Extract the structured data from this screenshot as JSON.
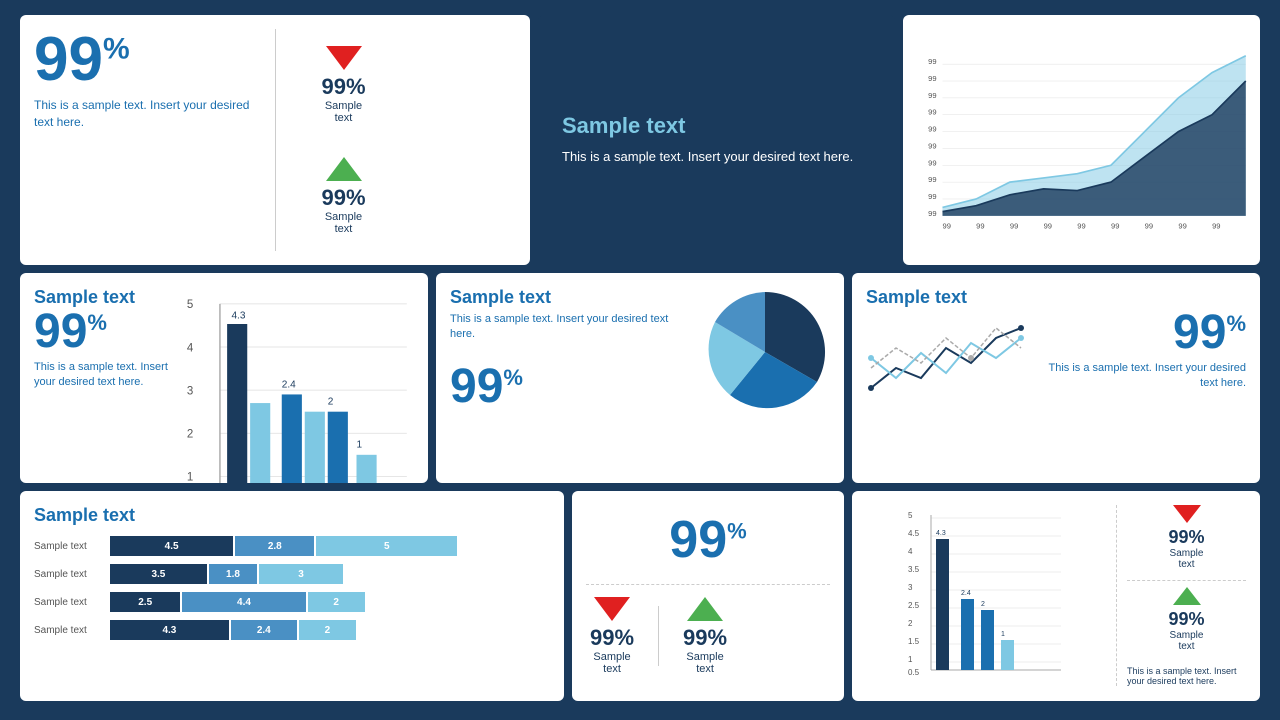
{
  "colors": {
    "dark_blue": "#1a3a5c",
    "mid_blue": "#1a6faf",
    "light_blue": "#7ec8e3",
    "accent_blue": "#4a90c4",
    "red": "#e02020",
    "green": "#4caf50",
    "white": "#ffffff"
  },
  "card1": {
    "big_percent": "99",
    "big_suffix": "%",
    "desc": "This is a sample text. Insert your desired text here.",
    "arrow1": {
      "percent": "99%",
      "label": "Sample\ntext",
      "type": "down"
    },
    "arrow2": {
      "percent": "99%",
      "label": "Sample\ntext",
      "type": "up"
    }
  },
  "card_dark": {
    "title": "Sample text",
    "desc": "This is a sample text. Insert your desired text here."
  },
  "card_bar1": {
    "title": "Sample text",
    "big_percent": "99",
    "big_suffix": "%",
    "desc": "This is a sample text. Insert your desired text here.",
    "bars": [
      {
        "label": "4.3",
        "value": 4.3
      },
      {
        "label": "2.4",
        "value": 2.4
      },
      {
        "label": "2",
        "value": 2.0
      },
      {
        "label": "1",
        "value": 1.0
      }
    ]
  },
  "card_pie": {
    "title": "Sample text",
    "desc": "This is a sample text. Insert your desired text here.",
    "big_percent": "99",
    "big_suffix": "%",
    "slices": [
      {
        "color": "#1a3a5c",
        "pct": 40
      },
      {
        "color": "#1a6faf",
        "pct": 25
      },
      {
        "color": "#7ec8e3",
        "pct": 20
      },
      {
        "color": "#4a90c4",
        "pct": 15
      }
    ]
  },
  "card_spark": {
    "title": "Sample text",
    "big_percent": "99",
    "big_suffix": "%",
    "desc": "This is a sample text. Insert your desired text here."
  },
  "card_hbar": {
    "title": "Sample text",
    "rows": [
      {
        "label": "Sample text",
        "v1": 4.5,
        "v2": 2.8,
        "v3": 5
      },
      {
        "label": "Sample text",
        "v1": 3.5,
        "v2": 1.8,
        "v3": 3
      },
      {
        "label": "Sample text",
        "v1": 2.5,
        "v2": 4.4,
        "v3": 2
      },
      {
        "label": "Sample text",
        "v1": 4.3,
        "v2": 2.4,
        "v3": 2
      }
    ]
  },
  "card_arrow_stats": {
    "big_percent": "99",
    "big_suffix": "%",
    "arrow1": {
      "percent": "99%",
      "label": "Sample\ntext",
      "type": "down"
    },
    "arrow2": {
      "percent": "99%",
      "label": "Sample\ntext",
      "type": "up"
    }
  },
  "card_bar2": {
    "bars": [
      {
        "label": "4.3",
        "value": 4.3
      },
      {
        "label": "2.4",
        "value": 2.4
      },
      {
        "label": "2",
        "value": 2.0
      },
      {
        "label": "1",
        "value": 1.0
      }
    ],
    "arrow1": {
      "percent": "99%",
      "label": "Sample\ntext",
      "type": "down"
    },
    "arrow2": {
      "percent": "99%",
      "label": "Sample\ntext",
      "type": "up"
    },
    "desc": "This is a sample text. Insert your desired text here."
  },
  "line_chart": {
    "y_labels": [
      "99",
      "99",
      "99",
      "99",
      "99",
      "99",
      "99",
      "99",
      "99",
      "99"
    ],
    "x_labels": [
      "99",
      "99",
      "99",
      "99",
      "99",
      "99",
      "99",
      "99",
      "99"
    ]
  }
}
